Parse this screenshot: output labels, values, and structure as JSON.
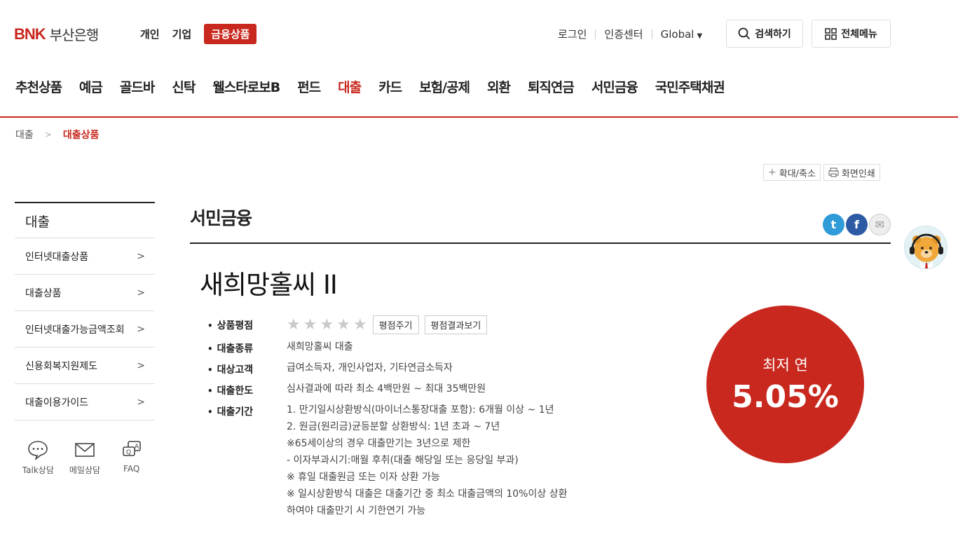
{
  "header": {
    "logo": {
      "bnk": "BNK",
      "bank": "부산은행"
    },
    "top_nav": [
      {
        "label": "개인"
      },
      {
        "label": "기업"
      },
      {
        "label": "금융상품",
        "active": true
      }
    ],
    "util": {
      "login": "로그인",
      "cert": "인증센터",
      "global": "Global"
    },
    "search_label": "검색하기",
    "menu_label": "전체메뉴",
    "gnb": [
      "추천상품",
      "예금",
      "골드바",
      "신탁",
      "웰스타로보B",
      "펀드",
      "대출",
      "카드",
      "보험/공제",
      "외환",
      "퇴직연금",
      "서민금융",
      "국민주택채권"
    ],
    "gnb_active": "대출"
  },
  "breadcrumb": {
    "root": "대출",
    "current": "대출상품"
  },
  "tools": {
    "zoom": "확대/축소",
    "print": "화면인쇄"
  },
  "sidebar": {
    "title": "대출",
    "items": [
      "인터넷대출상품",
      "대출상품",
      "인터넷대출가능금액조회",
      "신용회복지원제도",
      "대출이용가이드"
    ],
    "helpers": [
      "Talk상담",
      "메일상담",
      "FAQ"
    ]
  },
  "content": {
    "category_title": "서민금융",
    "product_name": "새희망홀씨 II",
    "rating": {
      "label": "상품평점",
      "stars": 0,
      "max": 5,
      "rate_button": "평점주기",
      "result_button": "평점결과보기"
    },
    "rows": [
      {
        "label": "대출종류",
        "value": "새희망홀씨 대출"
      },
      {
        "label": "대상고객",
        "value": "급여소득자, 개인사업자, 기타연금소득자"
      },
      {
        "label": "대출한도",
        "value": "심사결과에 따라 최소 4백만원 ~ 최대 35백만원"
      }
    ],
    "period": {
      "label": "대출기간",
      "lines": [
        "1. 만기일시상환방식(마이너스통장대출 포함): 6개월 이상 ~ 1년",
        "2. 원금(원리금)균등분할 상환방식: 1년 초과 ~ 7년",
        "※65세이상의 경우 대출만기는 3년으로 제한",
        "- 이자부과시기:매월 후취(대출 해당일 또는 응당일 부과)",
        "※ 휴일 대출원금 또는 이자 상환 가능",
        "※ 일시상환방식 대출은 대출기간 중 최소 대출금액의 10%이상 상환",
        "하여야 대출만기 시 기한연기 가능"
      ]
    },
    "rate": {
      "label": "최저 연",
      "value": "5.05%"
    }
  },
  "colors": {
    "brand": "#c8281e"
  }
}
